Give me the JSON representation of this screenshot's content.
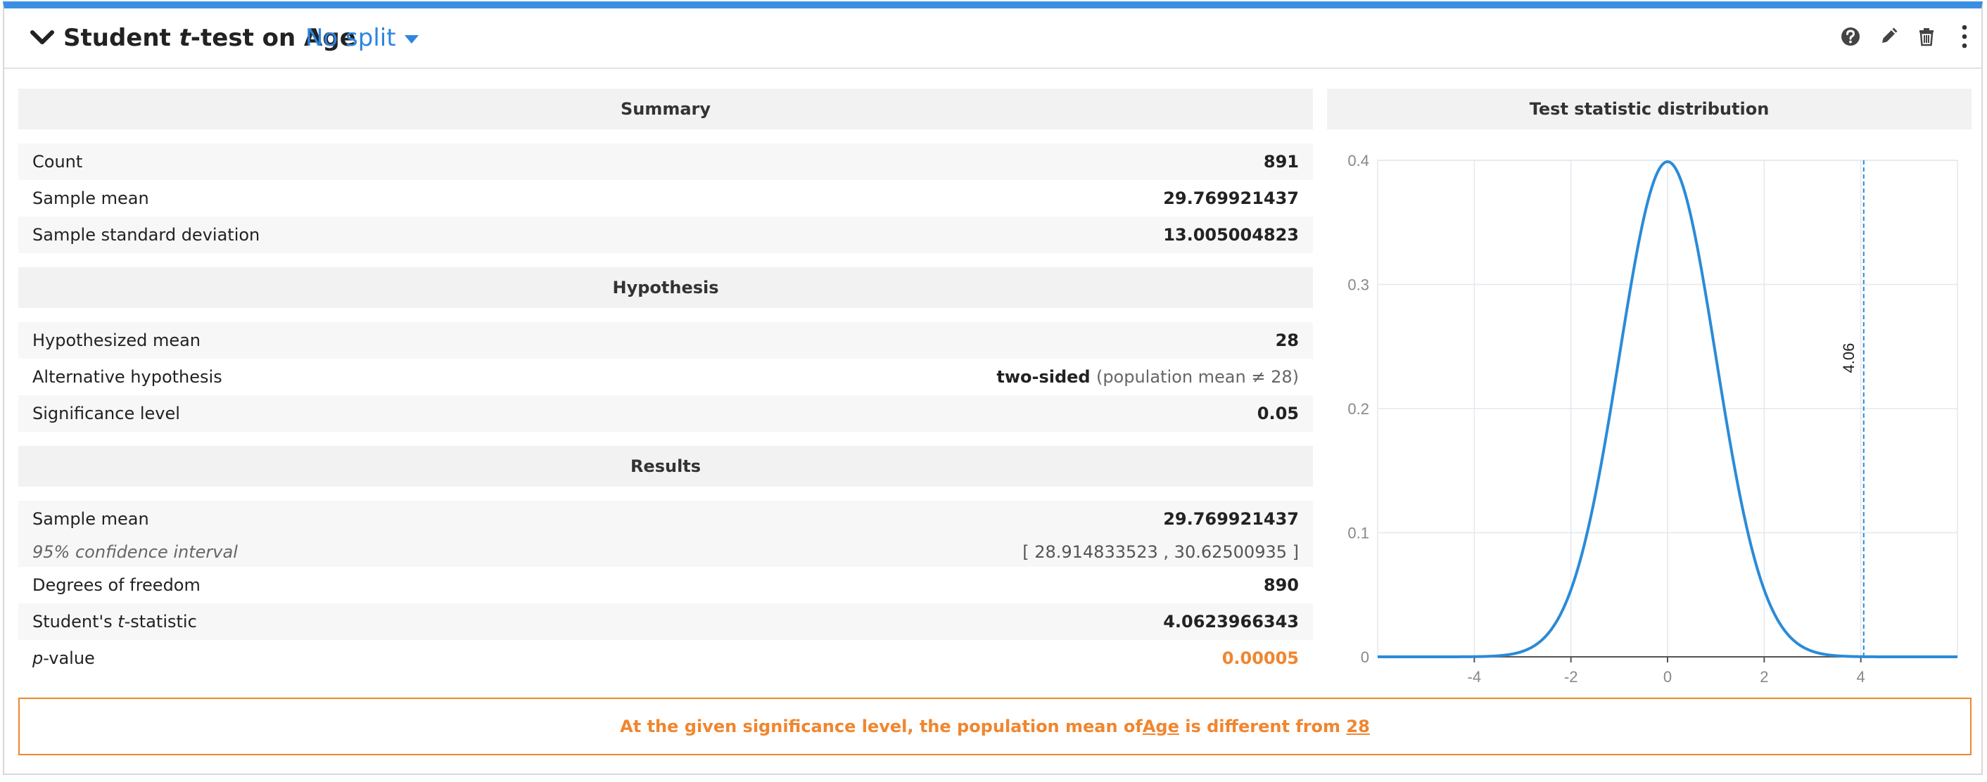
{
  "header": {
    "title_prefix": "Student ",
    "title_italic": "t",
    "title_suffix": "-test on Age",
    "split_label": "No split"
  },
  "summary": {
    "heading": "Summary",
    "rows": [
      {
        "label": "Count",
        "value": "891"
      },
      {
        "label": "Sample mean",
        "value": "29.769921437"
      },
      {
        "label": "Sample standard deviation",
        "value": "13.005004823"
      }
    ]
  },
  "hypothesis": {
    "heading": "Hypothesis",
    "hypothesized_mean_label": "Hypothesized mean",
    "hypothesized_mean_value": "28",
    "alternative_label": "Alternative hypothesis",
    "alternative_value": "two-sided",
    "alternative_detail": "(population mean ≠ 28)",
    "significance_label": "Significance level",
    "significance_value": "0.05"
  },
  "results": {
    "heading": "Results",
    "sample_mean_label": "Sample mean",
    "sample_mean_value": "29.769921437",
    "ci_label": "95% confidence interval",
    "ci_value": "[ 28.914833523 , 30.62500935 ]",
    "dof_label": "Degrees of freedom",
    "dof_value": "890",
    "tstat_label_prefix": "Student's ",
    "tstat_label_italic": "t",
    "tstat_label_suffix": "-statistic",
    "tstat_value": "4.0623966343",
    "pvalue_label_italic": "p",
    "pvalue_label_suffix": "-value",
    "pvalue_value": "0.00005"
  },
  "chart_title": "Test statistic distribution",
  "chart_data": {
    "type": "line",
    "title": "Test statistic distribution",
    "xlabel": "",
    "ylabel": "",
    "xlim": [
      -6,
      6
    ],
    "ylim": [
      0,
      0.4
    ],
    "x_ticks": [
      -4,
      -2,
      0,
      2,
      4
    ],
    "y_ticks": [
      0,
      0.1,
      0.2,
      0.3,
      0.4
    ],
    "x_tick_labels": [
      "-4",
      "-2",
      "0",
      "2",
      "4"
    ],
    "y_tick_labels": [
      "0",
      "0.1",
      "0.2",
      "0.3",
      "0.4"
    ],
    "grid": true,
    "curve_peak": 0.3989,
    "marker": {
      "x": 4.06,
      "label": "4.06"
    }
  },
  "conclusion": {
    "prefix": "At the given significance level, the population mean of ",
    "variable": "Age",
    "middle": " is different from ",
    "value": "28"
  },
  "colors": {
    "accent": "#3b8fe2",
    "link": "#2d86e0",
    "warning": "#f0862f",
    "curve": "#2a8bd8"
  },
  "icons": [
    "chevron-down-icon",
    "help-icon",
    "edit-icon",
    "trash-icon",
    "more-vertical-icon"
  ]
}
